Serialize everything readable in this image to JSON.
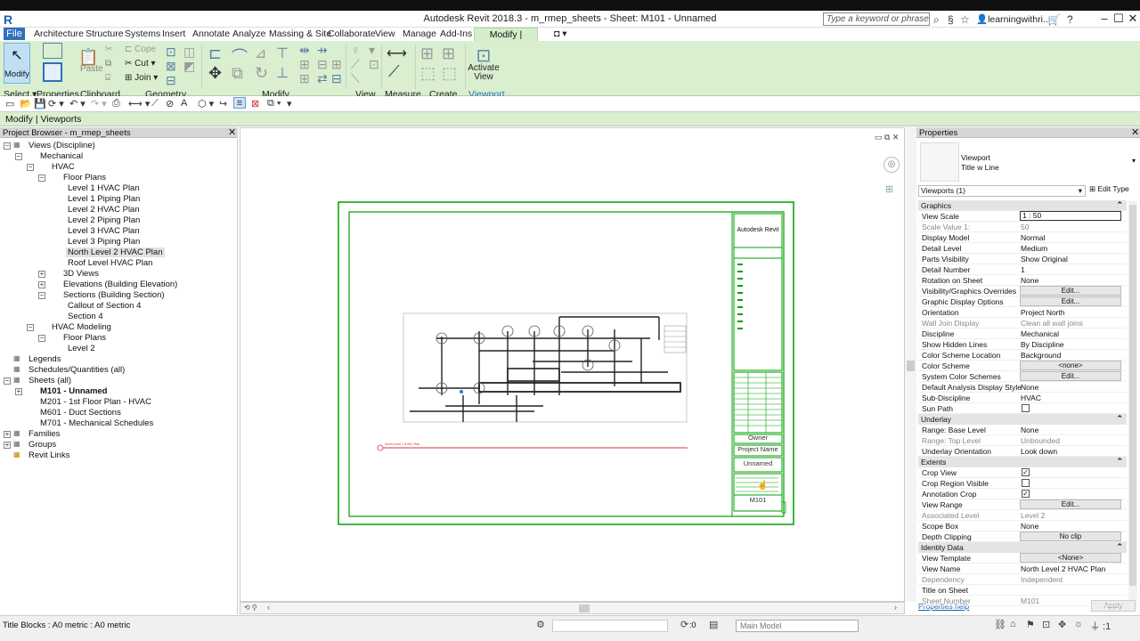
{
  "app": {
    "title": "Autodesk Revit 2018.3 -     m_rmep_sheets - Sheet: M101 - Unnamed",
    "logo": "R"
  },
  "titlebar": {
    "search_placeholder": "Type a keyword or phrase",
    "user": "learningwithri...",
    "minimize": "–",
    "maximize": "☐",
    "close": "✕"
  },
  "tabs": [
    "File",
    "Architecture",
    "Structure",
    "Systems",
    "Insert",
    "Annotate",
    "Analyze",
    "Massing & Site",
    "Collaborate",
    "View",
    "Manage",
    "Add-Ins",
    "Modify | Viewports"
  ],
  "ribbon": {
    "modify_label": "Modify",
    "paste_label": "Paste",
    "cope_label": "Cope",
    "cut_label": "Cut",
    "join_label": "Join",
    "activate_view_label": "Activate\nView",
    "panels": [
      "Select",
      "Properties",
      "Clipboard",
      "Geometry",
      "Modify",
      "View",
      "Measure",
      "Create",
      "Viewport"
    ]
  },
  "context_bar": {
    "label": "Modify | Viewports"
  },
  "project_browser": {
    "title": "Project Browser - m_rmep_sheets",
    "items": [
      {
        "label": "Views (Discipline)",
        "level": 0,
        "expander": "−"
      },
      {
        "label": "Mechanical",
        "level": 1,
        "expander": "−"
      },
      {
        "label": "HVAC",
        "level": 2,
        "expander": "−"
      },
      {
        "label": "Floor Plans",
        "level": 3,
        "expander": "−"
      },
      {
        "label": "Level 1 HVAC Plan",
        "level": 4
      },
      {
        "label": "Level 1 Piping Plan",
        "level": 4
      },
      {
        "label": "Level 2 HVAC Plan",
        "level": 4
      },
      {
        "label": "Level 2 Piping Plan",
        "level": 4
      },
      {
        "label": "Level 3 HVAC Plan",
        "level": 4
      },
      {
        "label": "Level 3 Piping Plan",
        "level": 4
      },
      {
        "label": "North Level 2 HVAC Plan",
        "level": 4,
        "selected": true
      },
      {
        "label": "Roof Level HVAC Plan",
        "level": 4
      },
      {
        "label": "3D Views",
        "level": 3,
        "expander": "+"
      },
      {
        "label": "Elevations (Building Elevation)",
        "level": 3,
        "expander": "+"
      },
      {
        "label": "Sections (Building Section)",
        "level": 3,
        "expander": "−"
      },
      {
        "label": "Callout of Section 4",
        "level": 4
      },
      {
        "label": "Section 4",
        "level": 4
      },
      {
        "label": "HVAC Modeling",
        "level": 2,
        "expander": "−"
      },
      {
        "label": "Floor Plans",
        "level": 3,
        "expander": "−"
      },
      {
        "label": "Level 2",
        "level": 4
      },
      {
        "label": "Legends",
        "level": 0,
        "expander": ""
      },
      {
        "label": "Schedules/Quantities (all)",
        "level": 0,
        "expander": ""
      },
      {
        "label": "Sheets (all)",
        "level": 0,
        "expander": "−"
      },
      {
        "label": "M101 - Unnamed",
        "level": 1,
        "expander": "+",
        "bold": true
      },
      {
        "label": "M201 - 1st Floor Plan - HVAC",
        "level": 1
      },
      {
        "label": "M601 - Duct Sections",
        "level": 1
      },
      {
        "label": "M701 - Mechanical Schedules",
        "level": 1
      },
      {
        "label": "Families",
        "level": 0,
        "expander": "+"
      },
      {
        "label": "Groups",
        "level": 0,
        "expander": "+"
      },
      {
        "label": "Revit Links",
        "level": 0
      }
    ]
  },
  "sheet": {
    "titleblock_company": "Autodesk Revit",
    "owner": "Owner",
    "project_name": "Project Name",
    "sheet_name": "Unnamed",
    "sheet_number": "M101",
    "viewport_title": "North Level 2 HVAC Plan"
  },
  "properties": {
    "title": "Properties",
    "type_family": "Viewport",
    "type_name": "Title w Line",
    "selector": "Viewports (1)",
    "edit_type": "Edit Type",
    "help": "Properties help",
    "apply": "Apply",
    "groups": [
      {
        "name": "Graphics",
        "rows": [
          {
            "name": "View Scale",
            "value": "1 : 50",
            "kind": "input"
          },
          {
            "name": "Scale Value    1:",
            "value": "50",
            "dim": true
          },
          {
            "name": "Display Model",
            "value": "Normal"
          },
          {
            "name": "Detail Level",
            "value": "Medium"
          },
          {
            "name": "Parts Visibility",
            "value": "Show Original"
          },
          {
            "name": "Detail Number",
            "value": "1"
          },
          {
            "name": "Rotation on Sheet",
            "value": "None"
          },
          {
            "name": "Visibility/Graphics Overrides",
            "value": "Edit...",
            "kind": "button"
          },
          {
            "name": "Graphic Display Options",
            "value": "Edit...",
            "kind": "button"
          },
          {
            "name": "Orientation",
            "value": "Project North"
          },
          {
            "name": "Wall Join Display",
            "value": "Clean all wall joins",
            "dim": true
          },
          {
            "name": "Discipline",
            "value": "Mechanical"
          },
          {
            "name": "Show Hidden Lines",
            "value": "By Discipline"
          },
          {
            "name": "Color Scheme Location",
            "value": "Background"
          },
          {
            "name": "Color Scheme",
            "value": "<none>",
            "kind": "button"
          },
          {
            "name": "System Color Schemes",
            "value": "Edit...",
            "kind": "button"
          },
          {
            "name": "Default Analysis Display Style",
            "value": "None"
          },
          {
            "name": "Sub-Discipline",
            "value": "HVAC"
          },
          {
            "name": "Sun Path",
            "value": "",
            "kind": "check",
            "checked": false
          }
        ]
      },
      {
        "name": "Underlay",
        "rows": [
          {
            "name": "Range: Base Level",
            "value": "None"
          },
          {
            "name": "Range: Top Level",
            "value": "Unbounded",
            "dim": true
          },
          {
            "name": "Underlay Orientation",
            "value": "Look down"
          }
        ]
      },
      {
        "name": "Extents",
        "rows": [
          {
            "name": "Crop View",
            "value": "",
            "kind": "check",
            "checked": true
          },
          {
            "name": "Crop Region Visible",
            "value": "",
            "kind": "check",
            "checked": false
          },
          {
            "name": "Annotation Crop",
            "value": "",
            "kind": "check",
            "checked": true
          },
          {
            "name": "View Range",
            "value": "Edit...",
            "kind": "button"
          },
          {
            "name": "Associated Level",
            "value": "Level 2",
            "dim": true
          },
          {
            "name": "Scope Box",
            "value": "None"
          },
          {
            "name": "Depth Clipping",
            "value": "No clip",
            "kind": "button"
          }
        ]
      },
      {
        "name": "Identity Data",
        "rows": [
          {
            "name": "View Template",
            "value": "<None>",
            "kind": "button"
          },
          {
            "name": "View Name",
            "value": "North Level 2 HVAC Plan"
          },
          {
            "name": "Dependency",
            "value": "Independent",
            "dim": true
          },
          {
            "name": "Title on Sheet",
            "value": ""
          },
          {
            "name": "Sheet Number",
            "value": "M101",
            "dim": true
          }
        ]
      }
    ]
  },
  "status": {
    "text": "Title Blocks : A0 metric : A0 metric",
    "zero": ":0",
    "main_model": "Main Model"
  },
  "colors": {
    "ribbon": "#d9efcf",
    "file_tab": "#2e6fbf",
    "selection": "#00a000",
    "red_line": "#e03030"
  }
}
